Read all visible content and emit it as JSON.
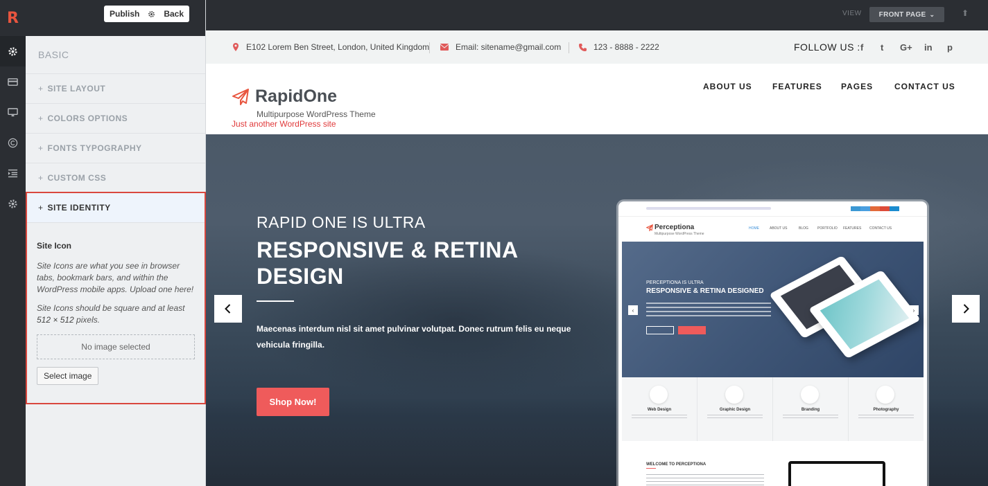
{
  "app": {
    "logo_letter": "R"
  },
  "rail": [
    "gear-icon",
    "card-icon",
    "monitor-icon",
    "copyright-icon",
    "list-indent-icon",
    "cog-icon"
  ],
  "panel": {
    "publish": "Publish",
    "back": "Back",
    "section": "BASIC",
    "accordion": [
      {
        "plus": "+",
        "label": "SITE LAYOUT"
      },
      {
        "plus": "+",
        "label": "COLORS OPTIONS"
      },
      {
        "plus": "+",
        "label": "FONTS TYPOGRAPHY"
      },
      {
        "plus": "+",
        "label": "CUSTOM CSS"
      }
    ],
    "identity": {
      "plus": "+",
      "label": "SITE IDENTITY",
      "site_icon_title": "Site Icon",
      "desc1": "Site Icons are what you see in browser tabs, bookmark bars, and within the WordPress mobile apps. Upload one here!",
      "desc2_a": "Site Icons should be square and at least ",
      "desc2_b": "512 × 512",
      "desc2_c": " pixels.",
      "no_image": "No image selected",
      "select_image": "Select image"
    }
  },
  "topbar": {
    "view_label": "VIEW",
    "front_page": "FRONT PAGE",
    "chevron": "⌄",
    "up": "⬆"
  },
  "site": {
    "address": "E102 Lorem Ben Street, London, United Kingdom",
    "email": "Email: sitename@gmail.com",
    "phone": "123 - 8888 - 2222",
    "follow": "FOLLOW US :",
    "social": [
      "f",
      "t",
      "G+",
      "in",
      "p"
    ],
    "brand": "RapidOne",
    "tagline1": "Multipurpose WordPress Theme",
    "tagline2": "Just another WordPress site",
    "nav": [
      "ABOUT US",
      "FEATURES",
      "PAGES",
      "CONTACT US"
    ],
    "hero": {
      "small": "RAPID ONE IS ULTRA",
      "big": "RESPONSIVE & RETINA DESIGN",
      "desc": "Maecenas interdum nisl sit amet pulvinar volutpat. Donec rutrum felis eu neque vehicula fringilla.",
      "cta": "Shop Now!"
    },
    "mockup": {
      "brand": "Perceptiona",
      "sub": "Multipurpose WordPress Theme",
      "nav": [
        "HOME",
        "ABOUT US",
        "BLOG",
        "PORTFOLIO",
        "FEATURES",
        "CONTACT US"
      ],
      "hero_small": "PERCEPTIONA IS ULTRA",
      "hero_big": "RESPONSIVE & RETINA DESIGNED",
      "features": [
        "Web Design",
        "Graphic Design",
        "Branding",
        "Photography"
      ],
      "welcome": "WELCOME TO PERCEPTIONA"
    }
  }
}
